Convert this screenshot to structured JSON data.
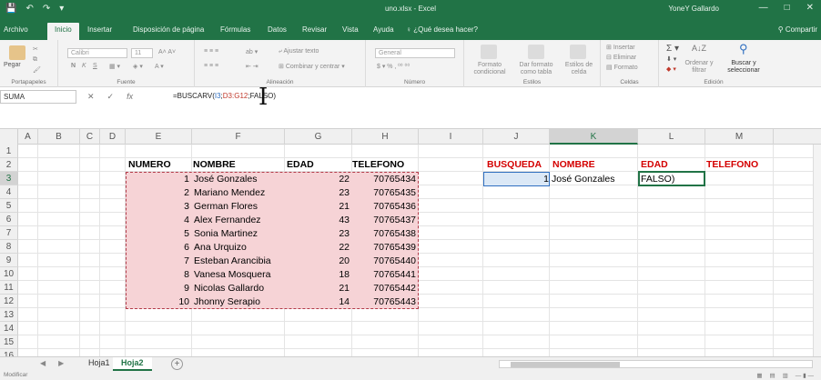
{
  "window": {
    "title": "uno.xlsx - Excel",
    "user": "YoneY Gallardo",
    "controls": [
      "—",
      "□",
      "✕"
    ]
  },
  "qat": [
    "💾",
    "↶",
    "↷",
    "▾"
  ],
  "ribbon_tabs": [
    "Archivo",
    "Inicio",
    "Insertar",
    "Disposición de página",
    "Fórmulas",
    "Datos",
    "Revisar",
    "Vista",
    "Ayuda",
    "¿Qué desea hacer?"
  ],
  "share_label": "Compartir",
  "ribbon": {
    "clipboard": {
      "paste": "Pegar",
      "label": "Portapapeles"
    },
    "font": {
      "name": "Calibri",
      "size": "11",
      "label": "Fuente"
    },
    "alignment": {
      "wrap": "Ajustar texto",
      "merge": "Combinar y centrar",
      "label": "Alineación"
    },
    "number": {
      "format": "General",
      "label": "Número"
    },
    "styles": {
      "conditional": "Formato condicional",
      "as_table": "Dar formato como tabla",
      "cell_styles": "Estilos de celda",
      "label": "Estilos"
    },
    "cells": {
      "insert": "Insertar",
      "delete": "Eliminar",
      "format": "Formato",
      "label": "Celdas"
    },
    "editing": {
      "sort": "Ordenar y filtrar",
      "find": "Buscar y seleccionar",
      "label": "Edición"
    }
  },
  "formula_bar": {
    "name_box": "SUMA",
    "fx": "fx",
    "formula_prefix": "=BUSCARV(",
    "ref1": "I3",
    "sep1": ";",
    "ref2": "D3:G12",
    "sep2": ";",
    "formula_suffix": "FALSO)"
  },
  "columns": [
    "A",
    "B",
    "C",
    "D",
    "E",
    "F",
    "G",
    "H",
    "I",
    "J",
    "K",
    "L",
    "M"
  ],
  "rows": [
    "1",
    "2",
    "3",
    "4",
    "5",
    "6",
    "7",
    "8",
    "9",
    "10",
    "11",
    "12",
    "13",
    "14",
    "15",
    "16"
  ],
  "table": {
    "headers": {
      "numero": "NUMERO",
      "nombre": "NOMBRE",
      "edad": "EDAD",
      "telefono": "TELEFONO"
    },
    "rows": [
      {
        "numero": "1",
        "nombre": "José Gonzales",
        "edad": "22",
        "telefono": "70765434"
      },
      {
        "numero": "2",
        "nombre": "Mariano Mendez",
        "edad": "23",
        "telefono": "70765435"
      },
      {
        "numero": "3",
        "nombre": "German Flores",
        "edad": "21",
        "telefono": "70765436"
      },
      {
        "numero": "4",
        "nombre": "Alex Fernandez",
        "edad": "43",
        "telefono": "70765437"
      },
      {
        "numero": "5",
        "nombre": "Sonia Martinez",
        "edad": "23",
        "telefono": "70765438"
      },
      {
        "numero": "6",
        "nombre": "Ana Urquizo",
        "edad": "22",
        "telefono": "70765439"
      },
      {
        "numero": "7",
        "nombre": "Esteban Arancibia",
        "edad": "20",
        "telefono": "70765440"
      },
      {
        "numero": "8",
        "nombre": "Vanesa Mosquera",
        "edad": "18",
        "telefono": "70765441"
      },
      {
        "numero": "9",
        "nombre": "Nicolas Gallardo",
        "edad": "21",
        "telefono": "70765442"
      },
      {
        "numero": "10",
        "nombre": "Jhonny Serapio",
        "edad": "14",
        "telefono": "70765443"
      }
    ]
  },
  "lookup": {
    "headers": {
      "busqueda": "BUSQUEDA",
      "nombre": "NOMBRE",
      "edad": "EDAD",
      "telefono": "TELEFONO"
    },
    "busqueda_value": "1",
    "nombre_value": "José Gonzales",
    "edad_value": "FALSO)"
  },
  "sheets": [
    "Hoja1",
    "Hoja2"
  ],
  "active_sheet": "Hoja2",
  "status": "Modificar",
  "colors": {
    "excel_green": "#217346",
    "header_red": "#d40000",
    "table_fill": "#f6d3d6"
  }
}
